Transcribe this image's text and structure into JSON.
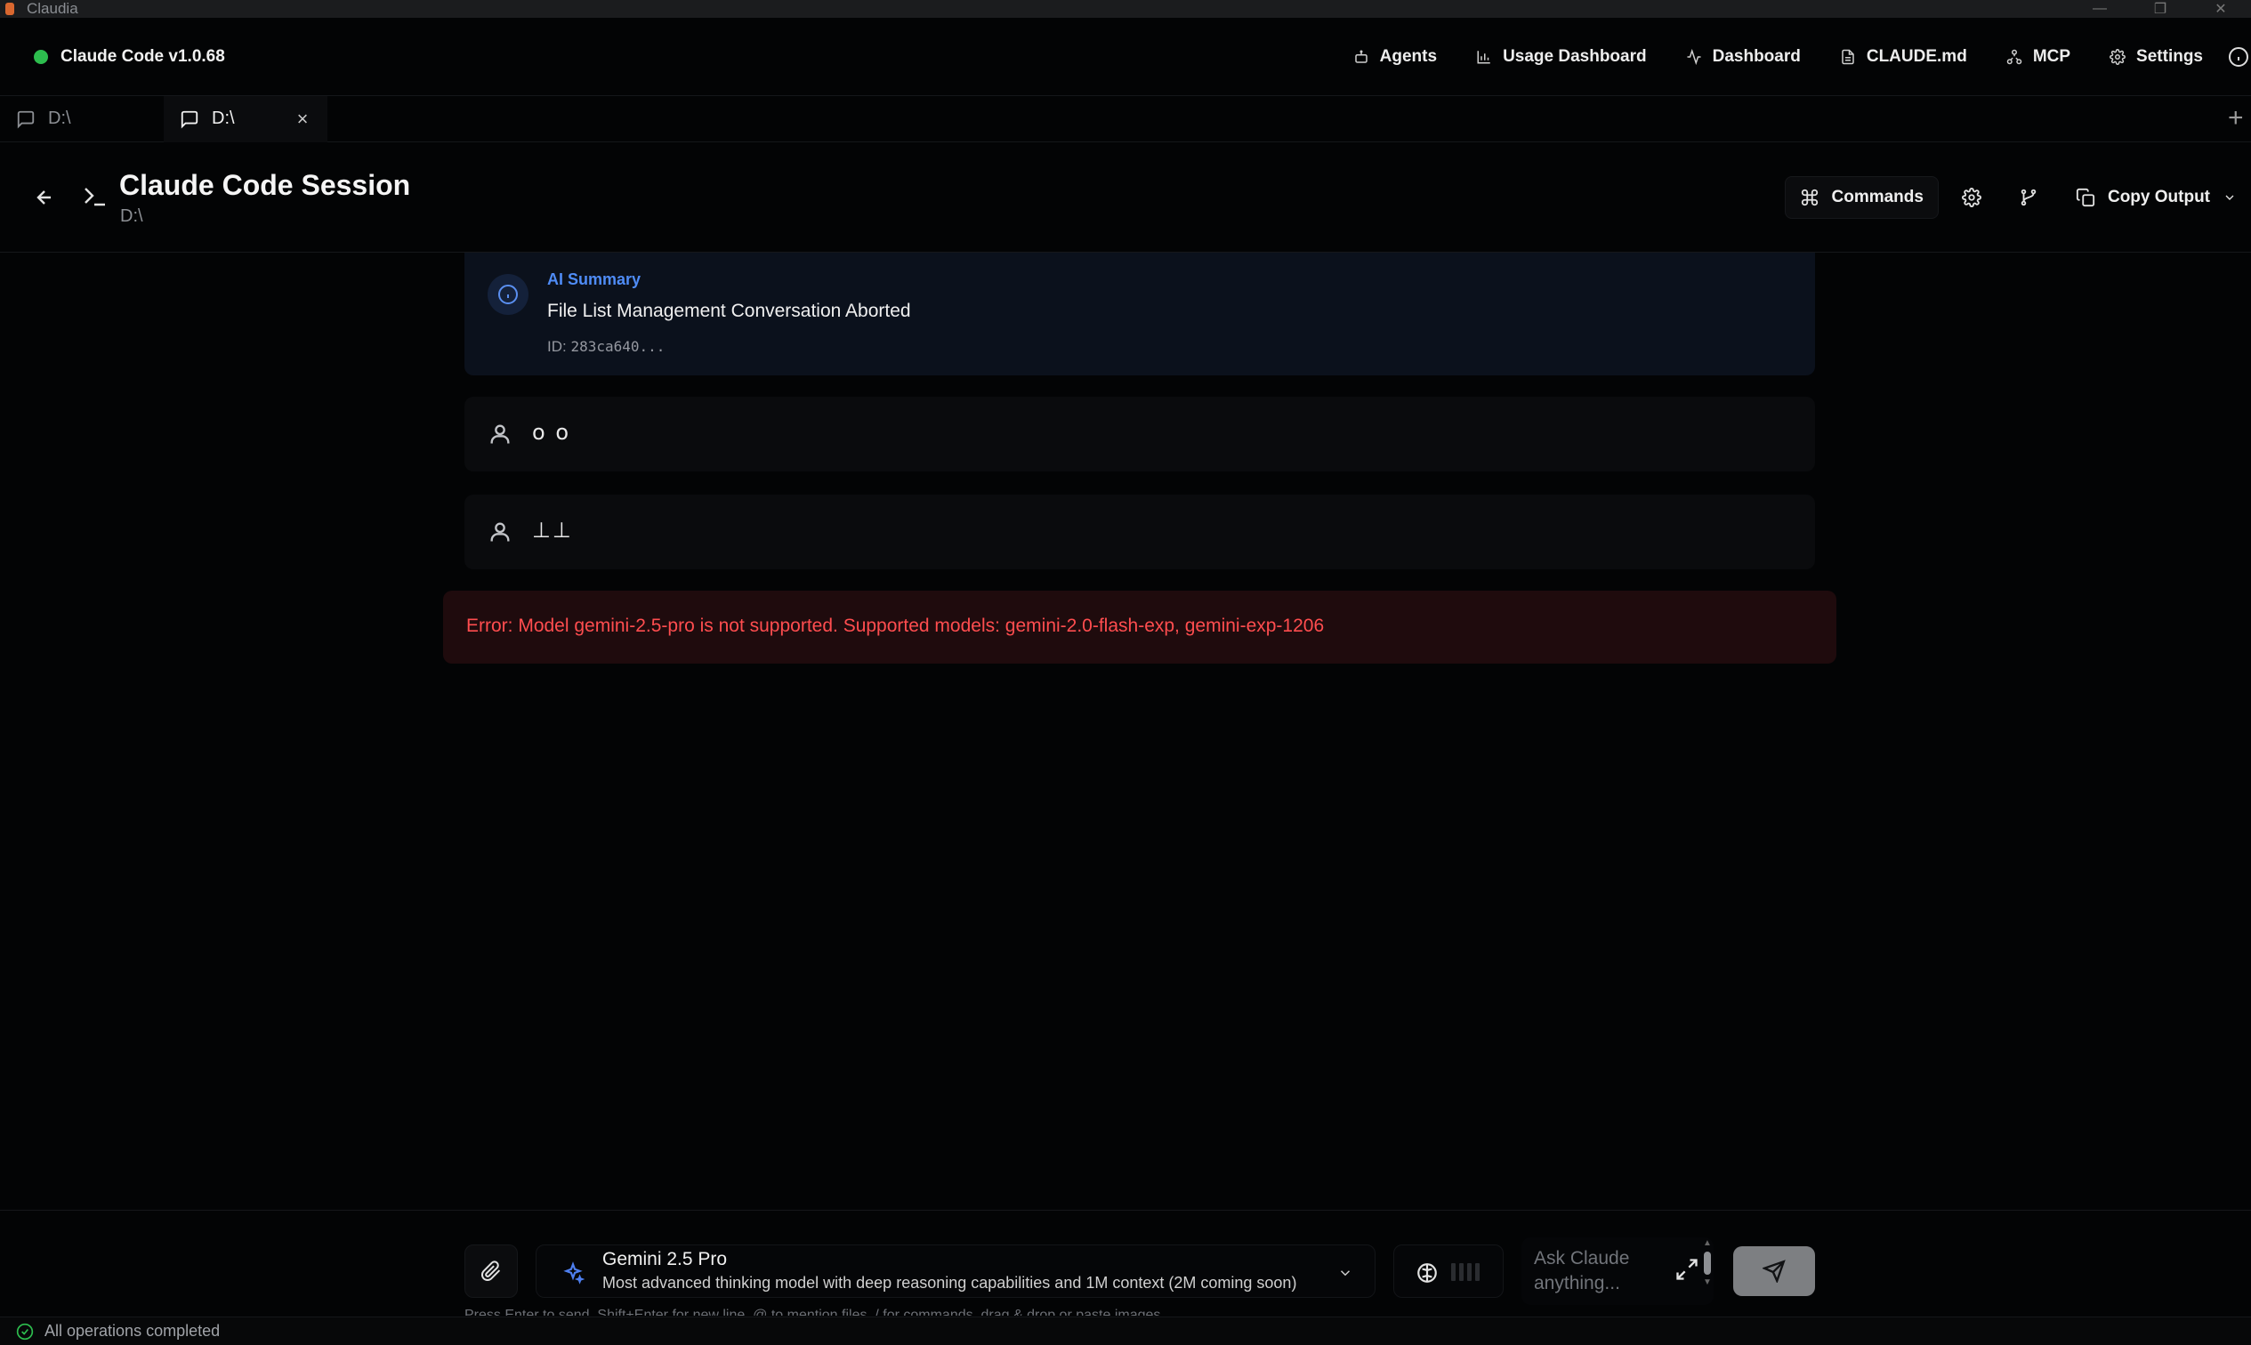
{
  "window": {
    "title": "Claudia",
    "controls": [
      "—",
      "❐",
      "✕"
    ]
  },
  "topnav": {
    "brand": "Claude Code v1.0.68",
    "status_color": "#2dbd4e",
    "items": [
      {
        "label": "Agents",
        "icon": "bot-icon"
      },
      {
        "label": "Usage Dashboard",
        "icon": "bar-chart-icon"
      },
      {
        "label": "Dashboard",
        "icon": "activity-icon"
      },
      {
        "label": "CLAUDE.md",
        "icon": "file-text-icon"
      },
      {
        "label": "MCP",
        "icon": "network-icon"
      },
      {
        "label": "Settings",
        "icon": "gear-icon"
      }
    ],
    "info_icon": "info-icon"
  },
  "tabs": [
    {
      "label": "D:\\",
      "active": false
    },
    {
      "label": "D:\\",
      "active": true,
      "close": "×"
    }
  ],
  "tab_add": "+",
  "session": {
    "title": "Claude Code Session",
    "path": "D:\\",
    "actions": {
      "commands": "Commands",
      "copy_output": "Copy Output"
    }
  },
  "messages": {
    "summary": {
      "label": "AI Summary",
      "title": "File List Management Conversation Aborted",
      "id_prefix": "ID: ",
      "id_value": "283ca640..."
    },
    "user_messages": [
      "o o",
      "⊥⊥"
    ],
    "error": "Error: Model gemini-2.5-pro is not supported. Supported models: gemini-2.0-flash-exp, gemini-exp-1206"
  },
  "input": {
    "model_name": "Gemini 2.5 Pro",
    "model_description": "Most advanced thinking model with deep reasoning capabilities and 1M context (2M coming soon)",
    "placeholder": "Ask Claude anything...",
    "hint": "Press Enter to send, Shift+Enter for new line, @ to mention files, / for commands, drag & drop or paste images"
  },
  "statusbar": {
    "text": "All operations completed"
  },
  "colors": {
    "accent_blue": "#4f8cf6",
    "error_red": "#ff4d4f",
    "success_green": "#2dbd4e"
  }
}
